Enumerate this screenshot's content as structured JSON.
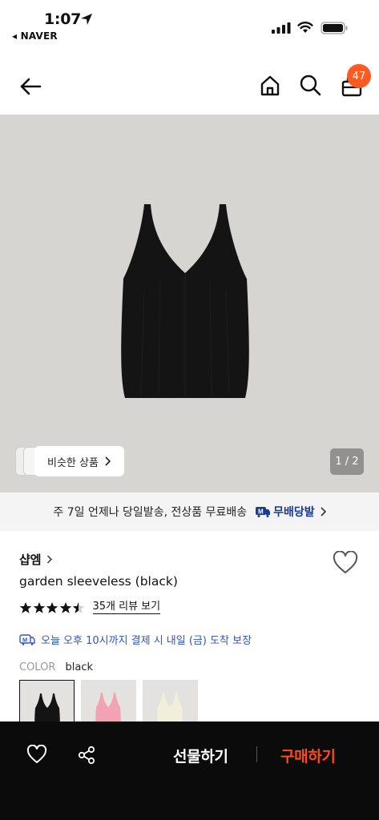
{
  "status_bar": {
    "time": "1:07",
    "back_app": "◂ NAVER"
  },
  "nav": {
    "cart_count": "47"
  },
  "hero": {
    "similar_label": "비슷한 상품",
    "page_counter": "1 / 2",
    "background": "#d7d5d2"
  },
  "delivery_strip": {
    "text": "주 7일 언제나 당일발송, 전상품 무료배송",
    "badge_label": "무배당발"
  },
  "product": {
    "shop_name": "샵엠",
    "title": "garden sleeveless (black)",
    "rating": 4.5,
    "review_link": "35개 리뷰 보기",
    "delivery_promise": "오늘 오후 10시까지 결제 시 내일 (금) 도착 보장",
    "color_label": "COLOR",
    "color_value": "black",
    "swatches": [
      {
        "name": "black",
        "color": "#141414",
        "selected": true
      },
      {
        "name": "pink",
        "color": "#f2a3b3",
        "selected": false
      },
      {
        "name": "cream",
        "color": "#f1eed9",
        "selected": false
      }
    ]
  },
  "bottom_bar": {
    "gift_label": "선물하기",
    "buy_label": "구매하기",
    "buy_color": "#ff4b12"
  }
}
